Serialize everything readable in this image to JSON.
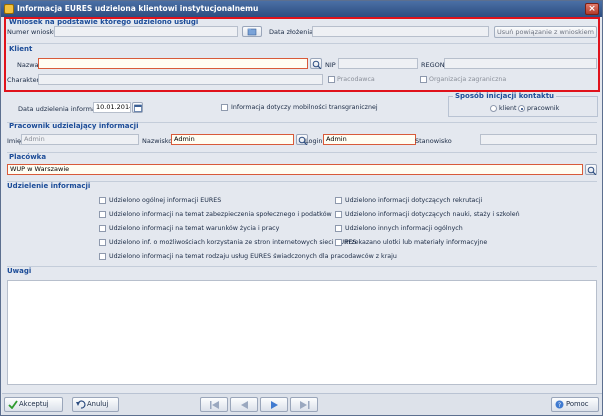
{
  "window": {
    "title": "Informacja EURES udzielona klientowi instytucjonalnemu",
    "close_glyph": "×"
  },
  "wniosek": {
    "title": "Wniosek na podstawie którego udzielono usługi",
    "numer_label": "Numer wniosku",
    "data_label": "Data złożenia",
    "unlink_label": "Usuń powiązanie z wnioskiem"
  },
  "klient": {
    "title": "Klient",
    "nazwa_label": "Nazwa",
    "nip_label": "NIP",
    "regon_label": "REGON",
    "charakter_label": "Charakter",
    "pracodawca_label": "Pracodawca",
    "org_label": "Organizacja zagraniczna"
  },
  "info": {
    "date_label": "Data udzielenia informacji",
    "date_value": "10.01.2014",
    "mobility_label": "Informacja dotyczy mobilności transgranicznej"
  },
  "kontakt": {
    "title": "Sposób inicjacji kontaktu",
    "options": [
      "klient",
      "pracownik"
    ],
    "selected": "pracownik"
  },
  "pracownik": {
    "title": "Pracownik udzielający informacji",
    "imie_label": "Imię",
    "imie_value": "Admin",
    "nazwisko_label": "Nazwisko",
    "nazwisko_value": "Admin",
    "login_label": "Login",
    "login_value": "Admin",
    "stanowisko_label": "Stanowisko"
  },
  "placowka": {
    "title": "Placówka",
    "value": "WUP w Warszawie"
  },
  "udzielenie": {
    "title": "Udzielenie informacji",
    "left": [
      "Udzielono ogólnej informacji EURES",
      "Udzielono informacji na temat zabezpieczenia społecznego i podatków",
      "Udzielono informacji na temat warunków życia i pracy",
      "Udzielono inf. o możliwościach korzystania ze stron internetowych sieci EURES",
      "Udzielono informacji na temat rodzaju usług EURES świadczonych dla pracodawców z kraju"
    ],
    "right": [
      "Udzielono informacji dotyczących rekrutacji",
      "Udzielono informacji dotyczących nauki, staży i szkoleń",
      "Udzielono innych informacji ogólnych",
      "Przekazano ulotki lub materiały informacyjne"
    ]
  },
  "uwagi": {
    "title": "Uwagi"
  },
  "buttons": {
    "accept": "Akceptuj",
    "cancel": "Anuluj",
    "help": "Pomoc"
  },
  "colors": {
    "accent": "#1c4c98",
    "highlight": "#e0121b",
    "required": "#d85a3a"
  }
}
